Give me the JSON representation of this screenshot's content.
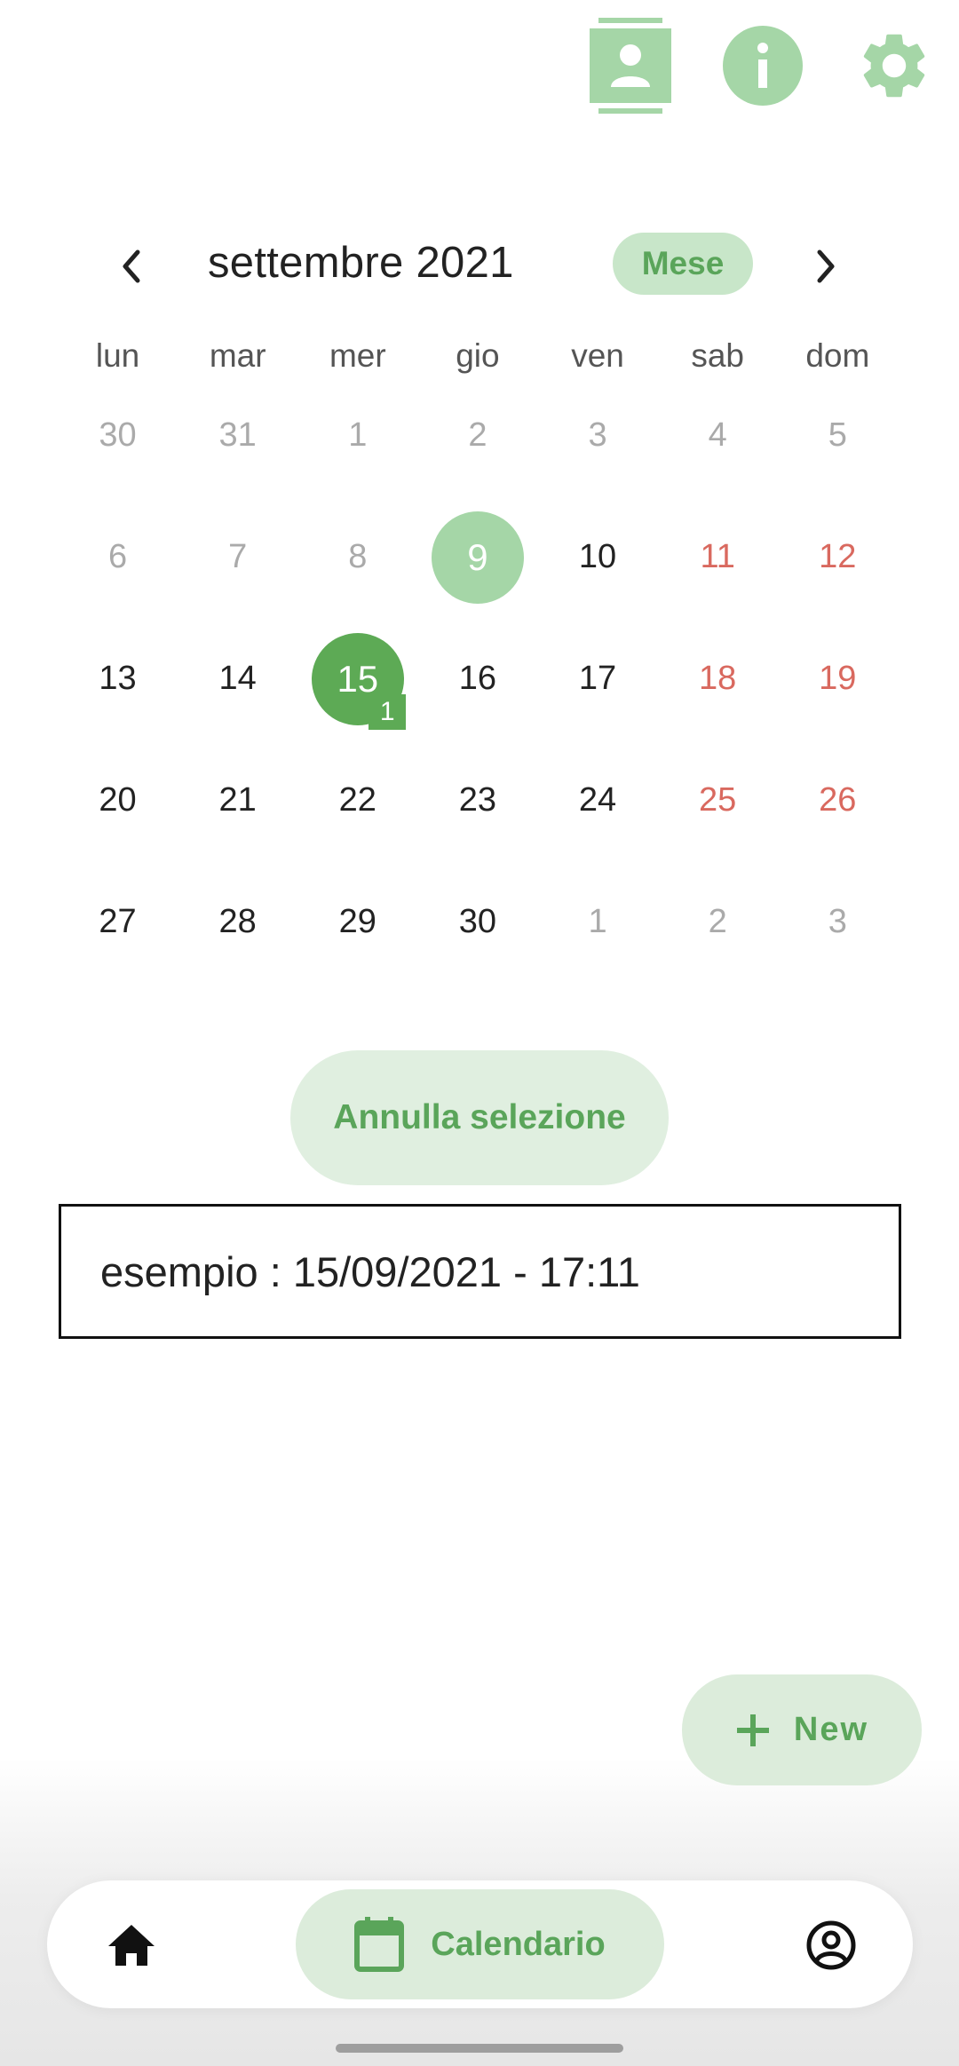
{
  "top_icons": {
    "contacts": "contact-book-icon",
    "info": "info-icon",
    "settings": "gear-icon",
    "color": "#a5d6a7"
  },
  "calendar": {
    "month_title": "settembre 2021",
    "mode_label": "Mese",
    "prev_icon": "chevron-left-icon",
    "next_icon": "chevron-right-icon",
    "weekdays": [
      "lun",
      "mar",
      "mer",
      "gio",
      "ven",
      "sab",
      "dom"
    ],
    "weeks": [
      [
        "30",
        "31",
        "1",
        "2",
        "3",
        "4",
        "5"
      ],
      [
        "6",
        "7",
        "8",
        "9",
        "10",
        "11",
        "12"
      ],
      [
        "13",
        "14",
        "15",
        "16",
        "17",
        "18",
        "19"
      ],
      [
        "20",
        "21",
        "22",
        "23",
        "24",
        "25",
        "26"
      ],
      [
        "27",
        "28",
        "29",
        "30",
        "1",
        "2",
        "3"
      ]
    ],
    "today": "9",
    "selected": "15",
    "selected_event_count": "1",
    "colors": {
      "accent": "#5daa55",
      "today_fill": "#a5d6a7",
      "weekend": "#d9695f",
      "muted": "#aaaaaa"
    }
  },
  "cancel_selection_label": "Annulla selezione",
  "events": [
    {
      "text": "esempio : 15/09/2021 - 17:11"
    }
  ],
  "fab": {
    "icon": "plus-icon",
    "label": "New"
  },
  "bottom_nav": {
    "home_icon": "home-icon",
    "calendar_icon": "calendar-icon",
    "calendar_label": "Calendario",
    "profile_icon": "account-circle-icon"
  }
}
